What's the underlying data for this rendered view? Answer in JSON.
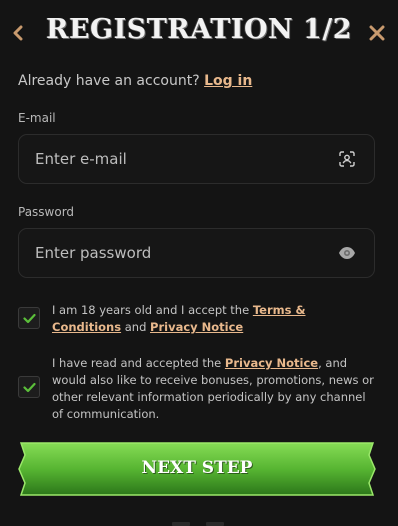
{
  "header": {
    "title": "REGISTRATION 1/2",
    "back_icon": "chevron-left-icon",
    "close_icon": "close-icon"
  },
  "login_prompt": {
    "text": "Already have an account?",
    "link_label": "Log in"
  },
  "email": {
    "label": "E-mail",
    "placeholder": "Enter e-mail",
    "icon": "face-scan-icon"
  },
  "password": {
    "label": "Password",
    "placeholder": "Enter password",
    "icon": "eye-icon"
  },
  "consents": [
    {
      "checked": true,
      "text_a": "I am 18 years old and I accept the ",
      "link_a": "Terms & Conditions",
      "text_b": " and ",
      "link_b": "Privacy Notice"
    },
    {
      "checked": true,
      "text_a": "I have read and accepted the ",
      "link_a": "Privacy Notice",
      "text_b": ", and would also like to receive bonuses, promotions, news or other relevant information periodically by any channel of communication."
    }
  ],
  "next_button": {
    "label": "NEXT STEP"
  },
  "colors": {
    "background": "#141414",
    "accent_link": "#e8b88c",
    "icon_tan": "#c89a6e",
    "check_green": "#5bbf3a",
    "button_green_top": "#7bd44a",
    "button_green_bottom": "#2f7d1c"
  }
}
